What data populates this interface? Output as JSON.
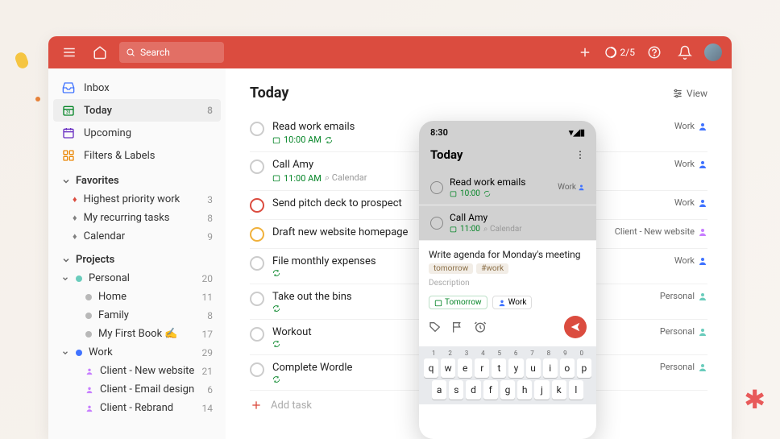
{
  "topbar": {
    "search_placeholder": "Search",
    "progress": "2/5"
  },
  "sidebar": {
    "inbox": "Inbox",
    "today": "Today",
    "today_count": "8",
    "upcoming": "Upcoming",
    "filters": "Filters & Labels",
    "favorites_label": "Favorites",
    "favorites": [
      {
        "label": "Highest priority work",
        "count": "3",
        "icon": "flame",
        "color": "#db4c3f"
      },
      {
        "label": "My recurring tasks",
        "count": "8",
        "icon": "flame",
        "color": "#808080"
      },
      {
        "label": "Calendar",
        "count": "9",
        "icon": "flame",
        "color": "#808080"
      }
    ],
    "projects_label": "Projects",
    "projects": [
      {
        "label": "Personal",
        "count": "20",
        "color": "#6accbc",
        "children": [
          {
            "label": "Home",
            "count": "11",
            "color": "#b8b8b8"
          },
          {
            "label": "Family",
            "count": "8",
            "color": "#b8b8b8"
          },
          {
            "label": "My First Book ✍️",
            "count": "17",
            "color": "#b8b8b8"
          }
        ]
      },
      {
        "label": "Work",
        "count": "29",
        "color": "#4073ff",
        "children": [
          {
            "label": "Client - New website",
            "count": "21",
            "icon": "person",
            "color": "#c77dff"
          },
          {
            "label": "Client - Email design",
            "count": "6",
            "icon": "person",
            "color": "#c77dff"
          },
          {
            "label": "Client - Rebrand",
            "count": "14",
            "icon": "person",
            "color": "#c77dff"
          }
        ]
      }
    ]
  },
  "main": {
    "title": "Today",
    "view_label": "View",
    "add_task": "Add task",
    "tasks": [
      {
        "title": "Read work emails",
        "time": "10:00 AM",
        "recurring": true,
        "tag": "Work",
        "tag_color": "#4073ff",
        "priority": ""
      },
      {
        "title": "Call Amy",
        "time": "11:00 AM",
        "extra": "Calendar",
        "tag": "Work",
        "tag_color": "#4073ff",
        "priority": ""
      },
      {
        "title": "Send pitch deck to prospect",
        "tag": "Work",
        "tag_color": "#4073ff",
        "priority": "p1"
      },
      {
        "title": "Draft new website homepage",
        "tag": "Client - New website",
        "tag_color": "#c77dff",
        "priority": "p2"
      },
      {
        "title": "File monthly expenses",
        "recurring": true,
        "tag": "Work",
        "tag_color": "#4073ff",
        "priority": ""
      },
      {
        "title": "Take out the bins",
        "recurring": true,
        "tag": "Personal",
        "tag_color": "#6accbc",
        "priority": ""
      },
      {
        "title": "Workout",
        "recurring": true,
        "tag": "Personal",
        "tag_color": "#6accbc",
        "priority": ""
      },
      {
        "title": "Complete Wordle",
        "recurring": true,
        "tag": "Personal",
        "tag_color": "#6accbc",
        "priority": ""
      }
    ]
  },
  "phone": {
    "time": "8:30",
    "title": "Today",
    "tasks": [
      {
        "title": "Read work emails",
        "time": "10:00",
        "recurring": true,
        "tag": "Work"
      },
      {
        "title": "Call Amy",
        "time": "11:00",
        "extra": "Calendar",
        "tag": ""
      }
    ],
    "compose": {
      "title": "Write agenda for Monday's meeting",
      "chip1": "tomorrow",
      "chip2": "#work",
      "description": "Description",
      "quick_tomorrow": "Tomorrow",
      "quick_work": "Work"
    },
    "keyboard": {
      "nums": [
        "1",
        "2",
        "3",
        "4",
        "5",
        "6",
        "7",
        "8",
        "9",
        "0"
      ],
      "row1": [
        "q",
        "w",
        "e",
        "r",
        "t",
        "y",
        "u",
        "i",
        "o",
        "p"
      ],
      "row2": [
        "a",
        "s",
        "d",
        "f",
        "g",
        "h",
        "j",
        "k",
        "l"
      ]
    }
  }
}
